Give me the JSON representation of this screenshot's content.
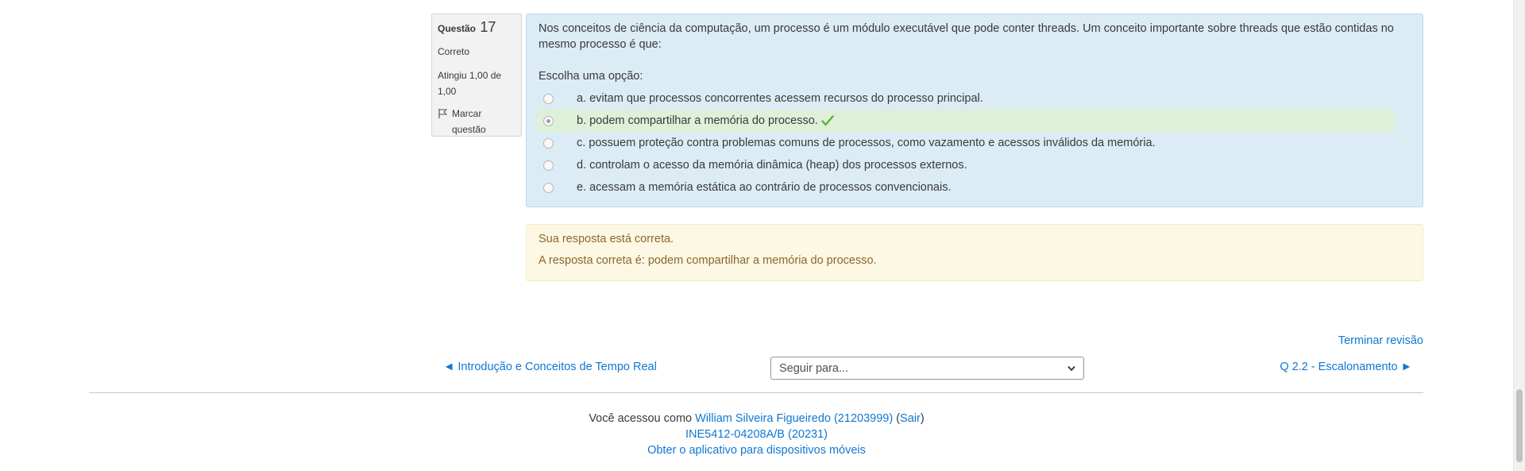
{
  "question": {
    "label": "Questão",
    "number": "17",
    "state": "Correto",
    "grade": "Atingiu 1,00 de 1,00",
    "flag_label": "Marcar questão",
    "text": "Nos conceitos de ciência da computação, um processo é um módulo executável que pode conter threads. Um conceito importante sobre threads que estão contidas no mesmo processo é que:",
    "prompt": "Escolha uma opção:",
    "options": [
      {
        "label": "a. evitam que processos concorrentes acessem recursos do processo principal.",
        "selected": false
      },
      {
        "label": "b. podem compartilhar a memória do processo.",
        "selected": true
      },
      {
        "label": "c. possuem proteção contra problemas comuns de processos, como vazamento e acessos inválidos da memória.",
        "selected": false
      },
      {
        "label": "d. controlam o acesso da memória dinâmica (heap) dos processos externos.",
        "selected": false
      },
      {
        "label": "e. acessam a memória estática ao contrário de processos convencionais.",
        "selected": false
      }
    ]
  },
  "feedback": {
    "status": "Sua resposta está correta.",
    "right_answer": "A resposta correta é: podem compartilhar a memória do processo."
  },
  "navigation": {
    "finish_review": "Terminar revisão",
    "prev": "◄ Introdução e Conceitos de Tempo Real",
    "jump_placeholder": "Seguir para...",
    "next": "Q 2.2 - Escalonamento ►"
  },
  "footer": {
    "logged_in_prefix": "Você acessou como",
    "user_name": "William Silveira Figueiredo (21203999)",
    "logout_open": "(",
    "logout": "Sair",
    "logout_close": ")",
    "course": "INE5412-04208A/B (20231)",
    "mobile_app": "Obter o aplicativo para dispositivos móveis"
  },
  "colors": {
    "link": "#1177d1",
    "formulation_bg": "#dcecf5",
    "selected_bg": "#dff0d8",
    "feedback_bg": "#fcf8e3",
    "feedback_text": "#8e662e",
    "check_green": "#5fb132"
  },
  "icons": {
    "flag": "flag-icon",
    "correct": "check-icon",
    "select": "chevron-down-icon"
  }
}
